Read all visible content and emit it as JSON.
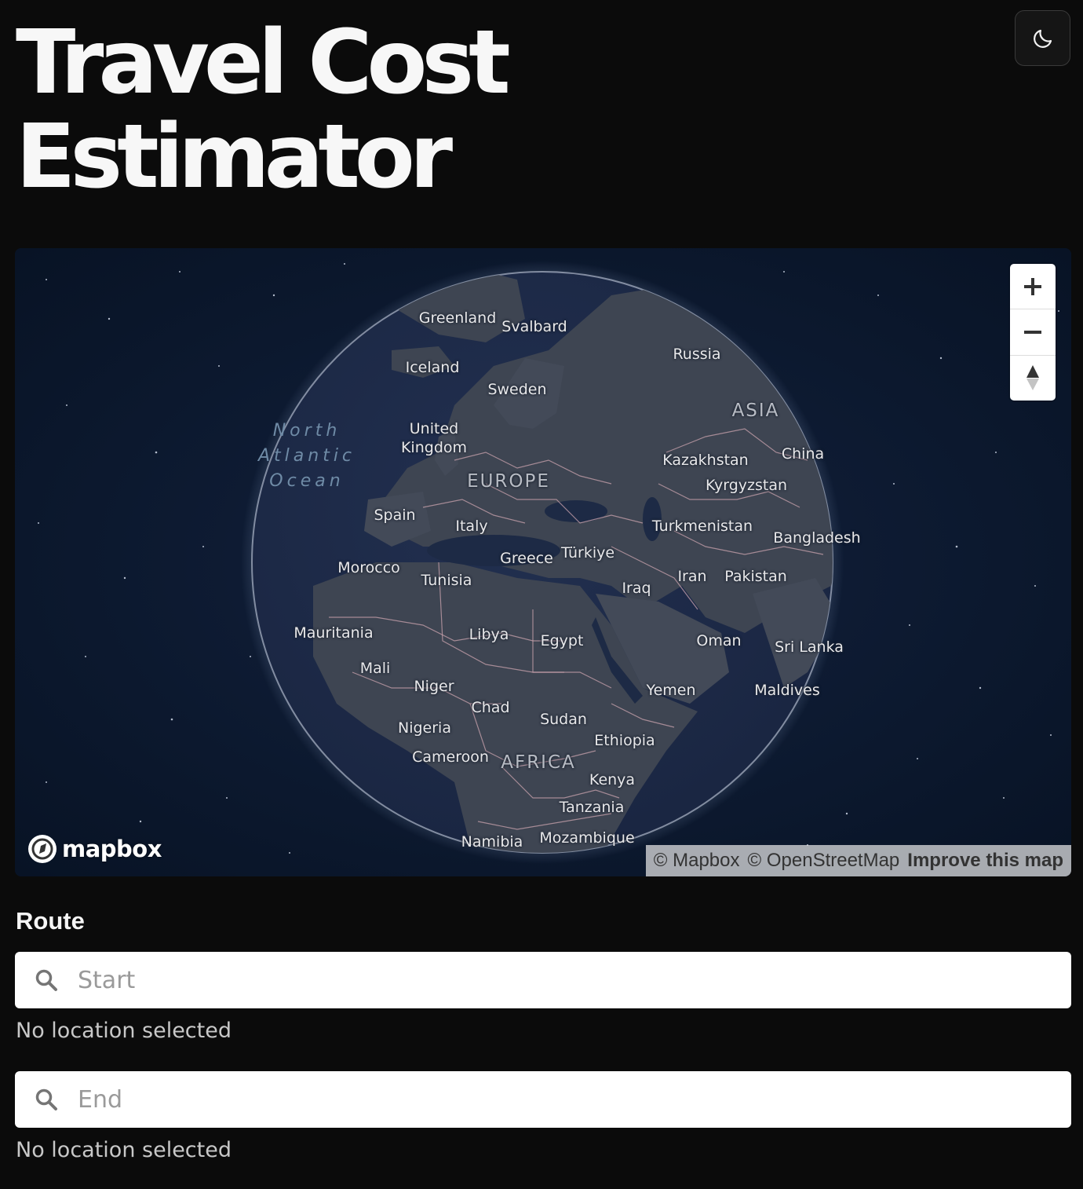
{
  "header": {
    "title_line1": "Travel Cost",
    "title_line2": "Estimator",
    "theme_toggle_icon": "moon-icon"
  },
  "map": {
    "labels": {
      "greenland": "Greenland",
      "svalbard": "Svalbard",
      "russia": "Russia",
      "iceland": "Iceland",
      "sweden": "Sweden",
      "asia": "ASIA",
      "ocean_line1": "North",
      "ocean_line2": "Atlantic",
      "ocean_line3": "Ocean",
      "united_kingdom_line1": "United",
      "united_kingdom_line2": "Kingdom",
      "kazakhstan": "Kazakhstan",
      "china": "China",
      "europe": "EUROPE",
      "kyrgyzstan": "Kyrgyzstan",
      "spain": "Spain",
      "italy": "Italy",
      "turkmenistan": "Turkmenistan",
      "bangladesh": "Bangladesh",
      "greece": "Greece",
      "turkiye": "Türkiye",
      "morocco": "Morocco",
      "tunisia": "Tunisia",
      "iraq": "Iraq",
      "iran": "Iran",
      "pakistan": "Pakistan",
      "mauritania": "Mauritania",
      "libya": "Libya",
      "egypt": "Egypt",
      "oman": "Oman",
      "sri_lanka": "Sri Lanka",
      "mali": "Mali",
      "niger": "Niger",
      "yemen": "Yemen",
      "maldives": "Maldives",
      "chad": "Chad",
      "sudan": "Sudan",
      "nigeria": "Nigeria",
      "ethiopia": "Ethiopia",
      "cameroon": "Cameroon",
      "africa": "AFRICA",
      "kenya": "Kenya",
      "tanzania": "Tanzania",
      "namibia": "Namibia",
      "mozambique": "Mozambique"
    },
    "controls": {
      "zoom_in_icon": "plus-icon",
      "zoom_out_icon": "minus-icon",
      "compass_icon": "compass-icon"
    },
    "logo_text": "mapbox",
    "attribution": {
      "mapbox": "© Mapbox",
      "osm": "© OpenStreetMap",
      "improve": "Improve this map"
    }
  },
  "route": {
    "label": "Route",
    "start": {
      "placeholder": "Start",
      "value": "",
      "status": "No location selected"
    },
    "end": {
      "placeholder": "End",
      "value": "",
      "status": "No location selected"
    }
  },
  "colors": {
    "background": "#0b0b0b",
    "map_space": "#0d1a30",
    "globe_land": "#3c4350",
    "globe_water": "#1d2a45",
    "borders": "#c9a3ad"
  }
}
